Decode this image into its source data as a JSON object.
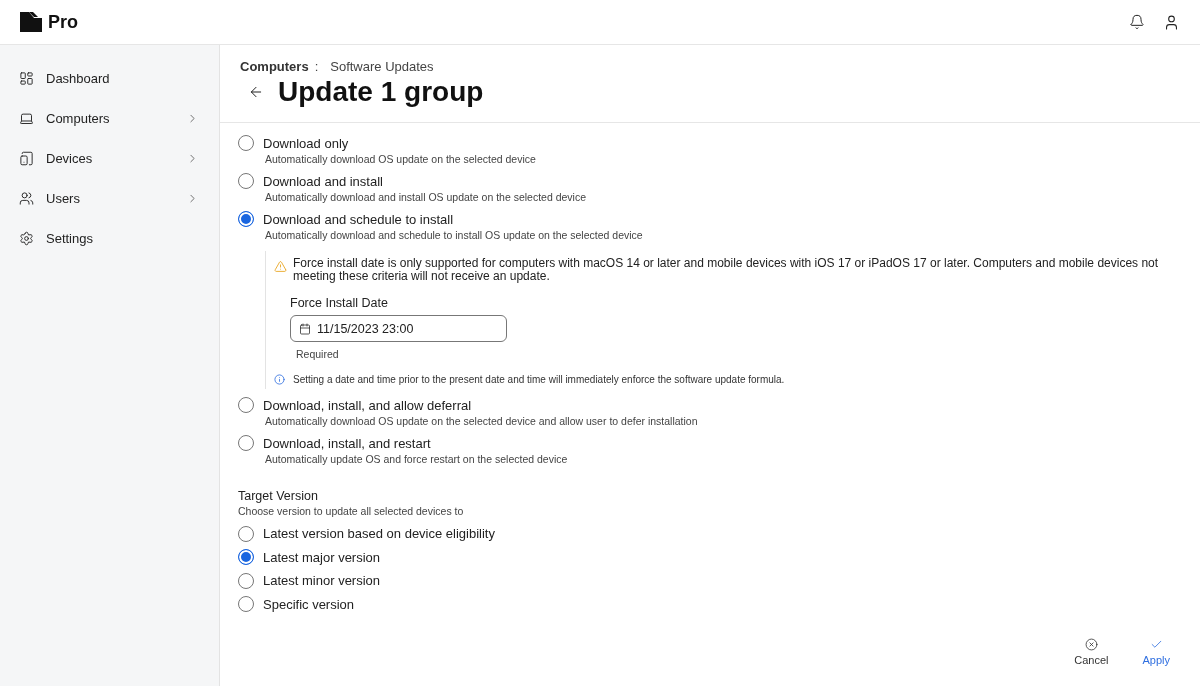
{
  "app": {
    "logo_text": "Pro"
  },
  "sidebar": {
    "items": [
      {
        "label": "Dashboard",
        "expandable": false
      },
      {
        "label": "Computers",
        "expandable": true
      },
      {
        "label": "Devices",
        "expandable": true
      },
      {
        "label": "Users",
        "expandable": true
      },
      {
        "label": "Settings",
        "expandable": false
      }
    ]
  },
  "breadcrumb": {
    "parent": "Computers",
    "separator": ":",
    "current": "Software Updates"
  },
  "title": "Update 1 group",
  "install_options": [
    {
      "label": "Download only",
      "description": "Automatically download OS update on the selected device",
      "selected": false
    },
    {
      "label": "Download and install",
      "description": "Automatically download and install OS update on the selected device",
      "selected": false
    },
    {
      "label": "Download and schedule to install",
      "description": "Automatically download and schedule to install OS update on the selected device",
      "selected": true,
      "details": {
        "warning": "Force install date is only supported for computers with macOS 14 or later and mobile devices with iOS 17 or iPadOS 17 or later. Computers and mobile devices not meeting these criteria will not receive an update.",
        "field_label": "Force Install Date",
        "field_value": "11/15/2023 23:00",
        "helper": "Required",
        "note": "Setting a date and time prior to the present date and time will immediately enforce the software update formula."
      }
    },
    {
      "label": "Download, install, and allow deferral",
      "description": "Automatically download OS update on the selected device and allow user to defer installation",
      "selected": false
    },
    {
      "label": "Download, install, and restart",
      "description": "Automatically update OS and force restart on the selected device",
      "selected": false
    }
  ],
  "target_version": {
    "title": "Target Version",
    "description": "Choose version to update all selected devices to",
    "options": [
      {
        "label": "Latest version based on device eligibility",
        "selected": false
      },
      {
        "label": "Latest major version",
        "selected": true
      },
      {
        "label": "Latest minor version",
        "selected": false
      },
      {
        "label": "Specific version",
        "selected": false
      }
    ]
  },
  "actions": [
    {
      "label": "Cancel",
      "kind": "cancel"
    },
    {
      "label": "Apply",
      "kind": "apply"
    }
  ]
}
